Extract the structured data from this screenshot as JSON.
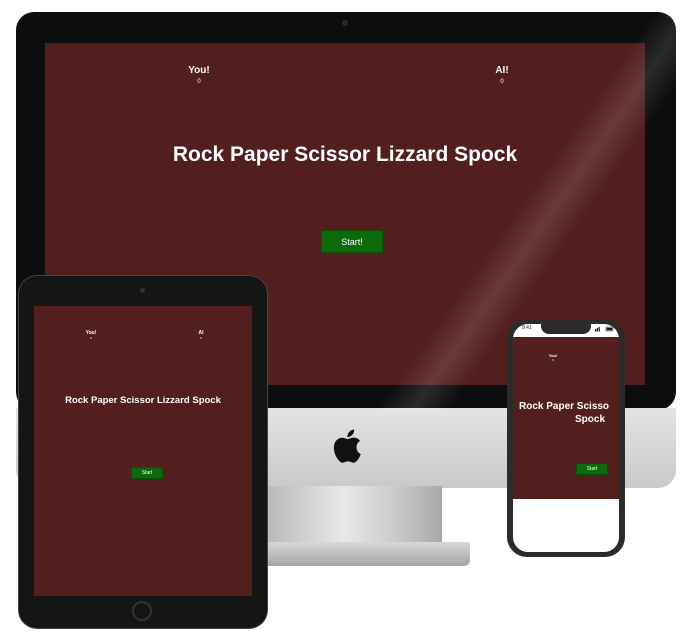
{
  "game": {
    "player_label": "You!",
    "ai_label": "AI!",
    "ai_label_small": "AI",
    "player_score": "0",
    "ai_score": "0",
    "title": "Rock Paper Scissor Lizzard Spock",
    "title_phone_line1": "Rock Paper Scisso",
    "title_phone_line2": "Spock",
    "start_label": "Start!",
    "start_label_small": "Start"
  },
  "phone": {
    "status_time": "9:41"
  },
  "colors": {
    "screen_bg": "#521e1e",
    "button_bg": "#0b6b0b",
    "text": "#ffffff"
  }
}
